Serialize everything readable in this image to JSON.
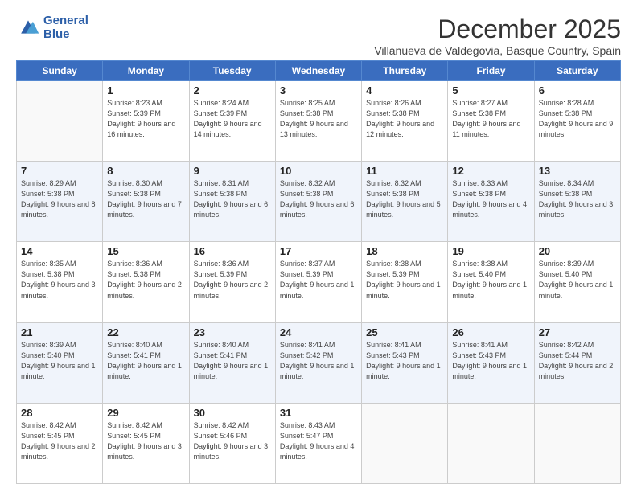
{
  "logo": {
    "line1": "General",
    "line2": "Blue"
  },
  "header": {
    "month": "December 2025",
    "location": "Villanueva de Valdegovia, Basque Country, Spain"
  },
  "days_of_week": [
    "Sunday",
    "Monday",
    "Tuesday",
    "Wednesday",
    "Thursday",
    "Friday",
    "Saturday"
  ],
  "weeks": [
    [
      {
        "day": "",
        "sunrise": "",
        "sunset": "",
        "daylight": ""
      },
      {
        "day": "1",
        "sunrise": "8:23 AM",
        "sunset": "5:39 PM",
        "daylight": "9 hours and 16 minutes."
      },
      {
        "day": "2",
        "sunrise": "8:24 AM",
        "sunset": "5:39 PM",
        "daylight": "9 hours and 14 minutes."
      },
      {
        "day": "3",
        "sunrise": "8:25 AM",
        "sunset": "5:38 PM",
        "daylight": "9 hours and 13 minutes."
      },
      {
        "day": "4",
        "sunrise": "8:26 AM",
        "sunset": "5:38 PM",
        "daylight": "9 hours and 12 minutes."
      },
      {
        "day": "5",
        "sunrise": "8:27 AM",
        "sunset": "5:38 PM",
        "daylight": "9 hours and 11 minutes."
      },
      {
        "day": "6",
        "sunrise": "8:28 AM",
        "sunset": "5:38 PM",
        "daylight": "9 hours and 9 minutes."
      }
    ],
    [
      {
        "day": "7",
        "sunrise": "8:29 AM",
        "sunset": "5:38 PM",
        "daylight": "9 hours and 8 minutes."
      },
      {
        "day": "8",
        "sunrise": "8:30 AM",
        "sunset": "5:38 PM",
        "daylight": "9 hours and 7 minutes."
      },
      {
        "day": "9",
        "sunrise": "8:31 AM",
        "sunset": "5:38 PM",
        "daylight": "9 hours and 6 minutes."
      },
      {
        "day": "10",
        "sunrise": "8:32 AM",
        "sunset": "5:38 PM",
        "daylight": "9 hours and 6 minutes."
      },
      {
        "day": "11",
        "sunrise": "8:32 AM",
        "sunset": "5:38 PM",
        "daylight": "9 hours and 5 minutes."
      },
      {
        "day": "12",
        "sunrise": "8:33 AM",
        "sunset": "5:38 PM",
        "daylight": "9 hours and 4 minutes."
      },
      {
        "day": "13",
        "sunrise": "8:34 AM",
        "sunset": "5:38 PM",
        "daylight": "9 hours and 3 minutes."
      }
    ],
    [
      {
        "day": "14",
        "sunrise": "8:35 AM",
        "sunset": "5:38 PM",
        "daylight": "9 hours and 3 minutes."
      },
      {
        "day": "15",
        "sunrise": "8:36 AM",
        "sunset": "5:38 PM",
        "daylight": "9 hours and 2 minutes."
      },
      {
        "day": "16",
        "sunrise": "8:36 AM",
        "sunset": "5:39 PM",
        "daylight": "9 hours and 2 minutes."
      },
      {
        "day": "17",
        "sunrise": "8:37 AM",
        "sunset": "5:39 PM",
        "daylight": "9 hours and 1 minute."
      },
      {
        "day": "18",
        "sunrise": "8:38 AM",
        "sunset": "5:39 PM",
        "daylight": "9 hours and 1 minute."
      },
      {
        "day": "19",
        "sunrise": "8:38 AM",
        "sunset": "5:40 PM",
        "daylight": "9 hours and 1 minute."
      },
      {
        "day": "20",
        "sunrise": "8:39 AM",
        "sunset": "5:40 PM",
        "daylight": "9 hours and 1 minute."
      }
    ],
    [
      {
        "day": "21",
        "sunrise": "8:39 AM",
        "sunset": "5:40 PM",
        "daylight": "9 hours and 1 minute."
      },
      {
        "day": "22",
        "sunrise": "8:40 AM",
        "sunset": "5:41 PM",
        "daylight": "9 hours and 1 minute."
      },
      {
        "day": "23",
        "sunrise": "8:40 AM",
        "sunset": "5:41 PM",
        "daylight": "9 hours and 1 minute."
      },
      {
        "day": "24",
        "sunrise": "8:41 AM",
        "sunset": "5:42 PM",
        "daylight": "9 hours and 1 minute."
      },
      {
        "day": "25",
        "sunrise": "8:41 AM",
        "sunset": "5:43 PM",
        "daylight": "9 hours and 1 minute."
      },
      {
        "day": "26",
        "sunrise": "8:41 AM",
        "sunset": "5:43 PM",
        "daylight": "9 hours and 1 minute."
      },
      {
        "day": "27",
        "sunrise": "8:42 AM",
        "sunset": "5:44 PM",
        "daylight": "9 hours and 2 minutes."
      }
    ],
    [
      {
        "day": "28",
        "sunrise": "8:42 AM",
        "sunset": "5:45 PM",
        "daylight": "9 hours and 2 minutes."
      },
      {
        "day": "29",
        "sunrise": "8:42 AM",
        "sunset": "5:45 PM",
        "daylight": "9 hours and 3 minutes."
      },
      {
        "day": "30",
        "sunrise": "8:42 AM",
        "sunset": "5:46 PM",
        "daylight": "9 hours and 3 minutes."
      },
      {
        "day": "31",
        "sunrise": "8:43 AM",
        "sunset": "5:47 PM",
        "daylight": "9 hours and 4 minutes."
      },
      {
        "day": "",
        "sunrise": "",
        "sunset": "",
        "daylight": ""
      },
      {
        "day": "",
        "sunrise": "",
        "sunset": "",
        "daylight": ""
      },
      {
        "day": "",
        "sunrise": "",
        "sunset": "",
        "daylight": ""
      }
    ]
  ],
  "labels": {
    "sunrise": "Sunrise:",
    "sunset": "Sunset:",
    "daylight": "Daylight:"
  }
}
